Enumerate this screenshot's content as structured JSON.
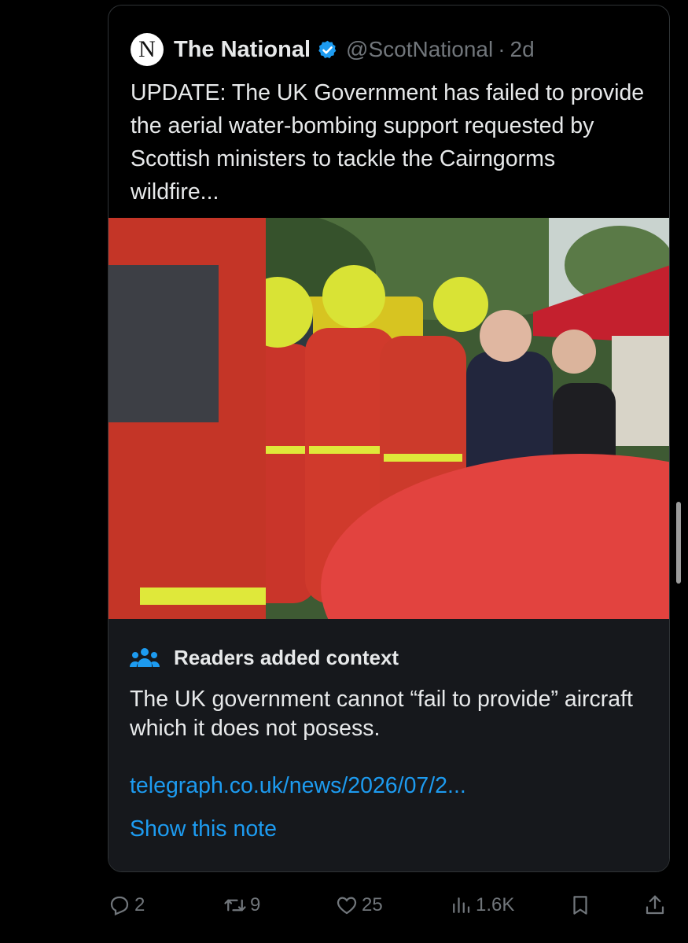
{
  "quoted_post": {
    "avatar_letter": "N",
    "author_name": "The National",
    "handle": "@ScotNational",
    "separator": "·",
    "time": "2d",
    "text": "UPDATE: The UK Government has failed to provide the aerial water-bombing support requested by Scottish ministers to tackle the Cairngorms wildfire...",
    "colors": {
      "verified": "#1d9bf0",
      "text": "#e7e9ea",
      "muted": "#71767b"
    }
  },
  "community_note": {
    "title": "Readers added context",
    "body": "The UK government cannot “fail to provide” aircraft which it does not posess.",
    "link": "telegraph.co.uk/news/2026/07/2...",
    "show_note": "Show this note",
    "colors": {
      "background": "#16181c",
      "link": "#1d9bf0"
    }
  },
  "actions": {
    "replies": "2",
    "reposts": "9",
    "likes": "25",
    "views": "1.6K"
  },
  "icons": [
    "reply-icon",
    "repost-icon",
    "like-icon",
    "views-icon",
    "bookmark-icon",
    "share-icon",
    "verified-badge-icon",
    "people-icon"
  ]
}
